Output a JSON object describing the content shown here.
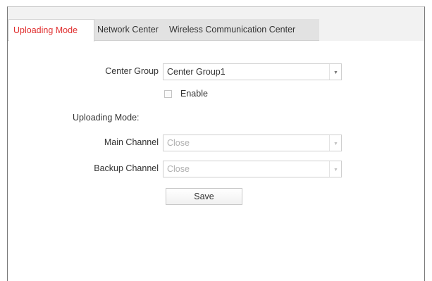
{
  "tabs": [
    {
      "label": "Uploading Mode",
      "active": true
    },
    {
      "label": "Network Center",
      "active": false
    },
    {
      "label": "Wireless Communication Center",
      "active": false
    }
  ],
  "form": {
    "center_group": {
      "label": "Center Group",
      "value": "Center Group1"
    },
    "enable": {
      "label": "Enable",
      "checked": false
    },
    "uploading_mode_heading": "Uploading Mode:",
    "main_channel": {
      "label": "Main Channel",
      "value": "Close",
      "disabled": true
    },
    "backup_channel": {
      "label": "Backup Channel",
      "value": "Close",
      "disabled": true
    },
    "save_label": "Save"
  },
  "colors": {
    "active_tab_text": "#e03030",
    "tabbar_bg": "#f2f2f2",
    "disabled_text": "#b0b0b0"
  },
  "icons": {
    "dropdown": "chevron-down-icon"
  }
}
